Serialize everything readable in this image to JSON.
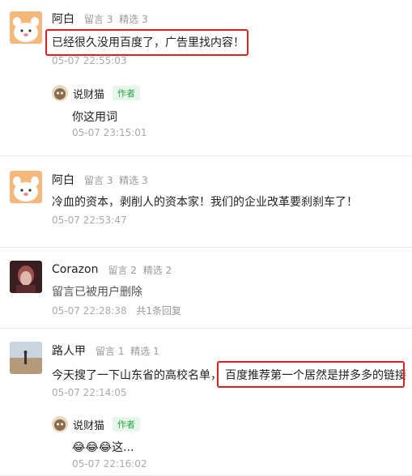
{
  "comments": [
    {
      "name": "阿白",
      "stats": [
        "留言 3",
        "精选 3"
      ],
      "text": "已经很久没用百度了，广告里找内容！",
      "time": "05-07 22:55:03",
      "reply": {
        "name": "说财猫",
        "badge": "作者",
        "text": "你这用词",
        "time": "05-07 23:15:01"
      }
    },
    {
      "name": "阿白",
      "stats": [
        "留言 3",
        "精选 3"
      ],
      "text": "冷血的资本，剥削人的资本家！我们的企业改革要刹刹车了！",
      "time": "05-07 22:53:47"
    },
    {
      "name": "Corazon",
      "stats": [
        "留言 2",
        "精选 2"
      ],
      "text": "留言已被用户删除",
      "time": "05-07 22:28:38",
      "reply_count": "共1条回复"
    },
    {
      "name": "路人甲",
      "stats": [
        "留言 1",
        "精选 1"
      ],
      "text_part1": "今天搜了一下山东省的高校名单，",
      "text_part2": "百度推荐第一个居然是拼多多的链接",
      "time": "05-07 22:14:05",
      "reply": {
        "name": "说财猫",
        "badge": "作者",
        "emoji": "😂😂😂",
        "text": "这...",
        "time": "05-07 22:16:02"
      }
    }
  ],
  "colors": {
    "highlight": "#e02020",
    "author_badge": "#28a745"
  }
}
